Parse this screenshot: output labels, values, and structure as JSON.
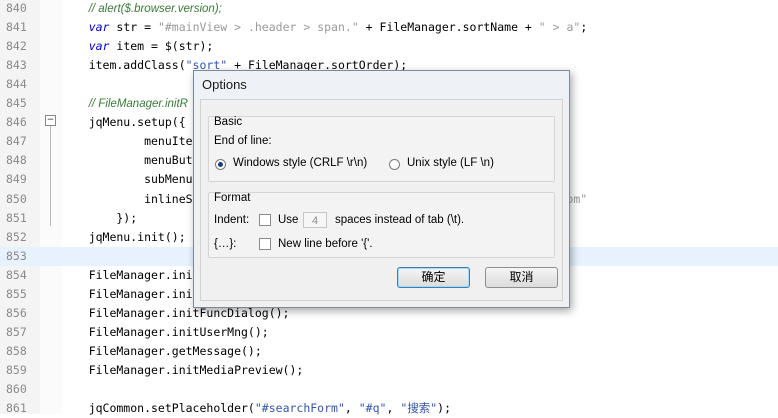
{
  "editor": {
    "lines": [
      {
        "n": "840",
        "parts": [
          [
            "    ",
            ""
          ],
          [
            "// alert($.browser.version);",
            "comment"
          ]
        ]
      },
      {
        "n": "841",
        "parts": [
          [
            "    ",
            ""
          ],
          [
            "var",
            "kw"
          ],
          [
            " str = ",
            ""
          ],
          [
            "\"#mainView > .header > span.\"",
            "str"
          ],
          [
            " + FileManager.sortName + ",
            ""
          ],
          [
            "\" > a\"",
            "str"
          ],
          [
            ";",
            ""
          ]
        ]
      },
      {
        "n": "842",
        "parts": [
          [
            "    ",
            ""
          ],
          [
            "var",
            "kw"
          ],
          [
            " item = $(str);",
            ""
          ]
        ]
      },
      {
        "n": "843",
        "parts": [
          [
            "    item.addClass(",
            ""
          ],
          [
            "\"sort\"",
            "strq"
          ],
          [
            " + FileManager.sortOrder);",
            ""
          ]
        ]
      },
      {
        "n": "844",
        "parts": []
      },
      {
        "n": "845",
        "parts": [
          [
            "    ",
            ""
          ],
          [
            "// FileManager.initR",
            "comment"
          ]
        ]
      },
      {
        "n": "846",
        "parts": [
          [
            "    jqMenu.setup({",
            ""
          ]
        ]
      },
      {
        "n": "847",
        "parts": [
          [
            "            menuIte",
            ""
          ]
        ]
      },
      {
        "n": "848",
        "parts": [
          [
            "            menuBut",
            ""
          ]
        ]
      },
      {
        "n": "849",
        "parts": [
          [
            "            subMenu",
            ""
          ]
        ]
      },
      {
        "n": "850",
        "parts": [
          [
            "            inlineS",
            ""
          ],
          [
            "                                          t right bottom\"",
            "str"
          ]
        ]
      },
      {
        "n": "851",
        "parts": [
          [
            "        });",
            ""
          ]
        ]
      },
      {
        "n": "852",
        "parts": [
          [
            "    jqMenu.init();",
            ""
          ]
        ]
      },
      {
        "n": "853",
        "parts": [],
        "current": true
      },
      {
        "n": "854",
        "parts": [
          [
            "    FileManager.init",
            ""
          ]
        ]
      },
      {
        "n": "855",
        "parts": [
          [
            "    FileManager.init",
            ""
          ]
        ]
      },
      {
        "n": "856",
        "parts": [
          [
            "    FileManager.initFuncDialog();",
            ""
          ]
        ]
      },
      {
        "n": "857",
        "parts": [
          [
            "    FileManager.initUserMng();",
            ""
          ]
        ]
      },
      {
        "n": "858",
        "parts": [
          [
            "    FileManager.getMessage();",
            ""
          ]
        ]
      },
      {
        "n": "859",
        "parts": [
          [
            "    FileManager.initMediaPreview();",
            ""
          ]
        ]
      },
      {
        "n": "860",
        "parts": []
      },
      {
        "n": "861",
        "parts": [
          [
            "    jqCommon.setPlaceholder(",
            ""
          ],
          [
            "\"#searchForm\"",
            "strq"
          ],
          [
            ", ",
            ""
          ],
          [
            "\"#q\"",
            "strq"
          ],
          [
            ", ",
            ""
          ],
          [
            "\"搜索\"",
            "strq"
          ],
          [
            ");",
            ""
          ]
        ]
      }
    ],
    "fold_marker": "−"
  },
  "dialog": {
    "title": "Options",
    "basic": {
      "group_label": "Basic",
      "eol_label": "End of line:",
      "option_windows": "Windows style (CRLF \\r\\n)",
      "option_unix": "Unix style (LF \\n)",
      "selected": "windows"
    },
    "format": {
      "group_label": "Format",
      "indent_label": "Indent:",
      "use_label": "Use",
      "spaces_value": "4",
      "spaces_suffix": "spaces instead of tab (\\t).",
      "brace_label": "{…}:",
      "newline_label": "New line before '{'."
    },
    "buttons": {
      "ok": "确定",
      "cancel": "取消"
    }
  }
}
